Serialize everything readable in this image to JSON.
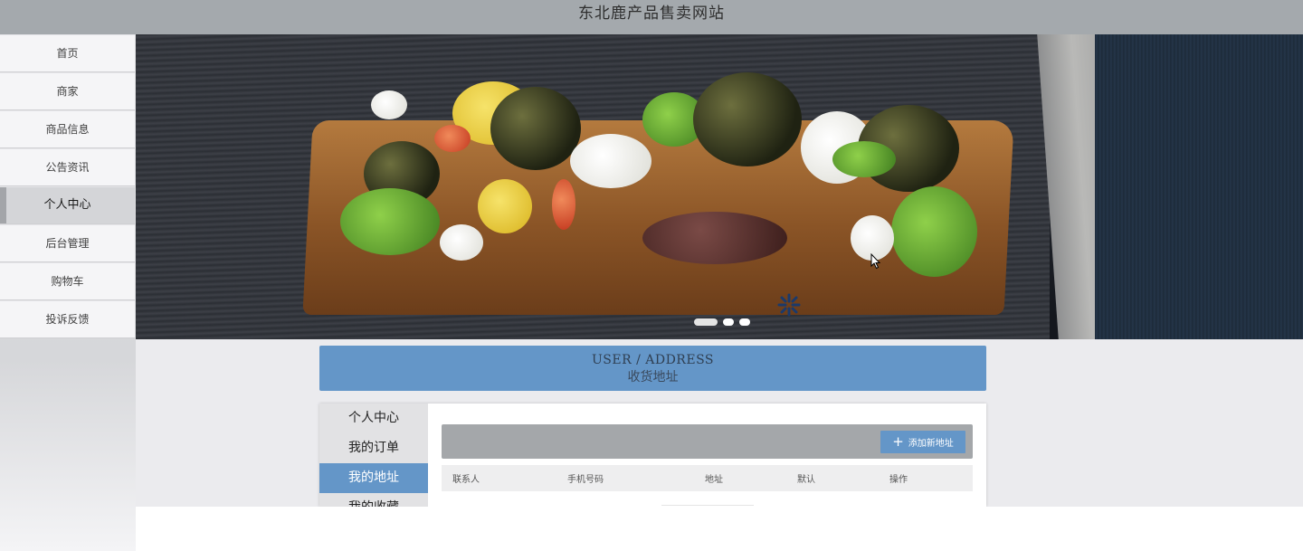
{
  "header": {
    "title": "东北鹿产品售卖网站"
  },
  "sidebar": {
    "items": [
      {
        "label": "首页"
      },
      {
        "label": "商家"
      },
      {
        "label": "商品信息"
      },
      {
        "label": "公告资讯"
      },
      {
        "label": "个人中心",
        "active": true
      },
      {
        "label": "后台管理"
      },
      {
        "label": "购物车"
      },
      {
        "label": "投诉反馈"
      }
    ]
  },
  "carousel": {
    "slide_count": 3,
    "active_index": 0
  },
  "section": {
    "title_en": "USER / ADDRESS",
    "title_cn": "收货地址"
  },
  "user_menu": {
    "items": [
      {
        "label": "个人中心"
      },
      {
        "label": "我的订单"
      },
      {
        "label": "我的地址",
        "active": true
      },
      {
        "label": "我的收藏"
      }
    ]
  },
  "toolbar": {
    "add_label": "添加新地址"
  },
  "table": {
    "columns": [
      "联系人",
      "手机号码",
      "地址",
      "默认",
      "操作"
    ],
    "rows": []
  },
  "colors": {
    "accent": "#6496c8",
    "topbar": "#a4a9ad",
    "page_bg": "#ebebee"
  }
}
